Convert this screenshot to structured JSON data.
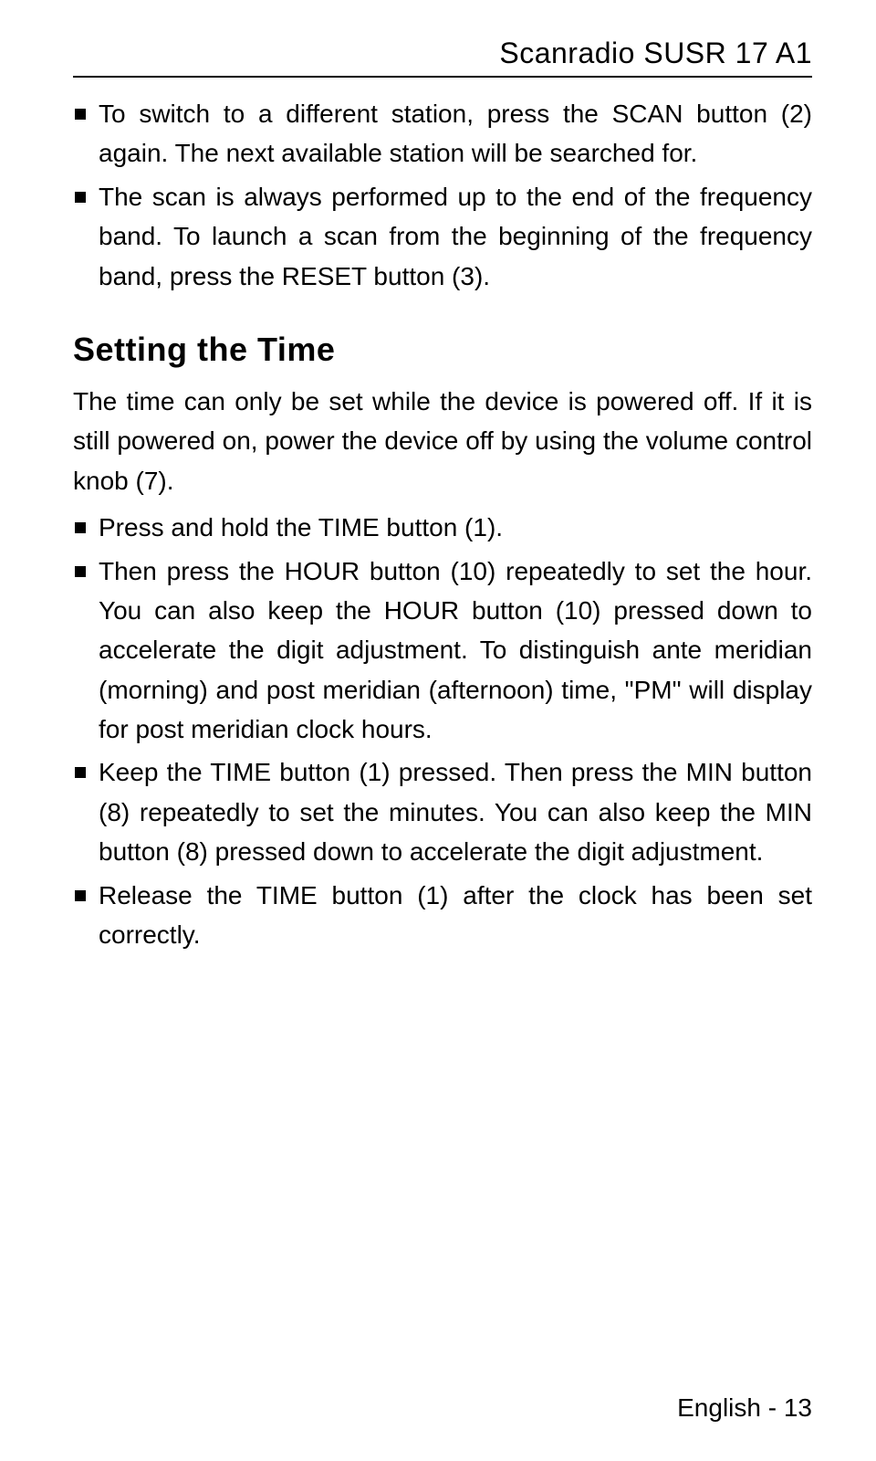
{
  "header": {
    "title": "Scanradio SUSR 17 A1"
  },
  "top_bullets": [
    "To switch to a different station, press the SCAN button (2) again. The next available station will be searched for.",
    "The scan is always performed up to the end of the frequency band. To launch a scan from the beginning of the frequency band, press the RESET button (3)."
  ],
  "section": {
    "heading": "Setting the Time",
    "intro": "The time can only be set while the device is powered off. If it is still powered on, power the device off by using the volume control knob (7).",
    "bullets": [
      "Press and hold the TIME button (1).",
      "Then press the HOUR button (10) repeatedly to set the hour. You can also keep the HOUR button (10) pressed down to accelerate the digit adjustment. To distinguish ante meridian (morning) and post meridian (afternoon) time, \"PM\" will display for post meridian clock hours.",
      "Keep the TIME button (1) pressed. Then press the MIN button (8) repeatedly to set the minutes. You can also keep the MIN button (8) pressed down to accelerate the digit adjustment.",
      "Release the TIME button (1) after the clock has been set correctly."
    ]
  },
  "footer": {
    "text": "English - 13"
  }
}
